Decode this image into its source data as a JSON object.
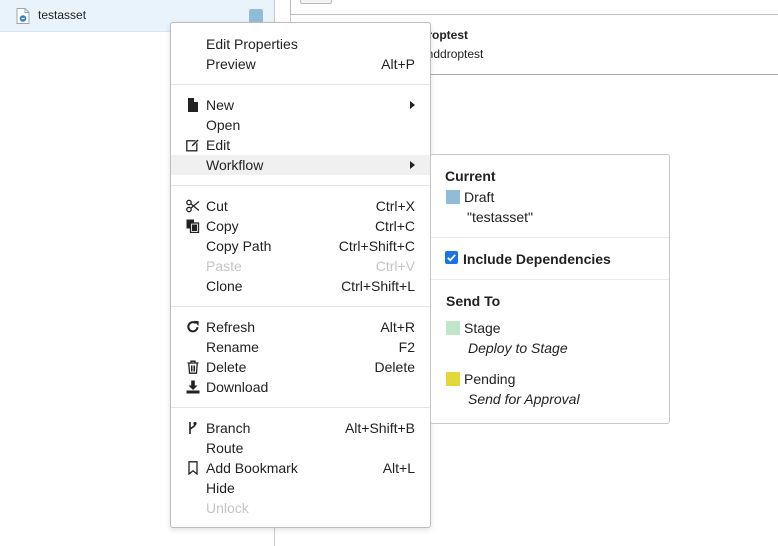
{
  "tree": {
    "asset_name": "testasset"
  },
  "card": {
    "title": "droptest",
    "subtitle": "anddroptest"
  },
  "menu": {
    "edit_properties": "Edit Properties",
    "preview": "Preview",
    "preview_shortcut": "Alt+P",
    "new": "New",
    "open": "Open",
    "edit": "Edit",
    "workflow": "Workflow",
    "cut": "Cut",
    "cut_shortcut": "Ctrl+X",
    "copy": "Copy",
    "copy_shortcut": "Ctrl+C",
    "copy_path": "Copy Path",
    "copy_path_shortcut": "Ctrl+Shift+C",
    "paste": "Paste",
    "paste_shortcut": "Ctrl+V",
    "clone": "Clone",
    "clone_shortcut": "Ctrl+Shift+L",
    "refresh": "Refresh",
    "refresh_shortcut": "Alt+R",
    "rename": "Rename",
    "rename_shortcut": "F2",
    "delete": "Delete",
    "delete_shortcut": "Delete",
    "download": "Download",
    "branch": "Branch",
    "branch_shortcut": "Alt+Shift+B",
    "route": "Route",
    "add_bookmark": "Add Bookmark",
    "add_bookmark_shortcut": "Alt+L",
    "hide": "Hide",
    "unlock": "Unlock"
  },
  "workflow": {
    "current_heading": "Current",
    "current_state": "Draft",
    "current_asset": "\"testasset\"",
    "include_dependencies": "Include Dependencies",
    "include_dependencies_checked": true,
    "send_to_heading": "Send To",
    "targets": [
      {
        "name": "Stage",
        "action": "Deploy to Stage",
        "color": "#bfe6c8"
      },
      {
        "name": "Pending",
        "action": "Send for Approval",
        "color": "#e2d83a"
      }
    ],
    "draft_color": "#8fbcd8"
  }
}
